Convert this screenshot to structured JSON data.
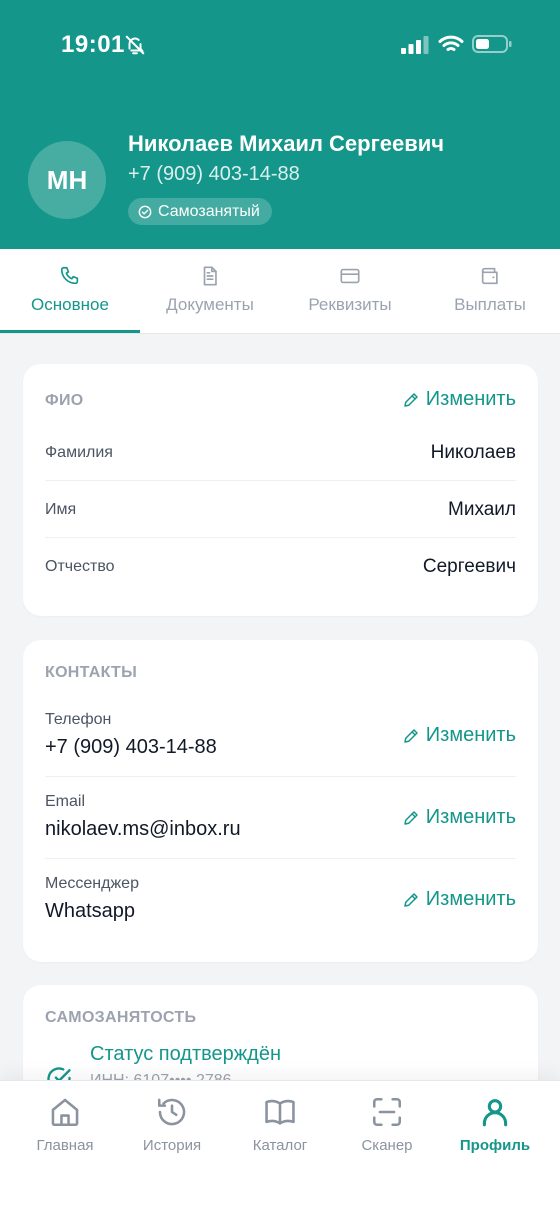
{
  "status_bar": {
    "time": "19:01"
  },
  "profile": {
    "initials": "МН",
    "name": "Николаев Михаил Сергеевич",
    "phone": "+7 (909) 403-14-88",
    "badge": "Самозанятый"
  },
  "tabs": [
    {
      "label": "Основное",
      "icon": "phone-icon",
      "active": true
    },
    {
      "label": "Документы",
      "icon": "document-icon"
    },
    {
      "label": "Реквизиты",
      "icon": "card-icon"
    },
    {
      "label": "Выплаты",
      "icon": "wallet-icon"
    }
  ],
  "fio": {
    "title": "ФИО",
    "edit": "Изменить",
    "rows": [
      {
        "label": "Фамилия",
        "value": "Николаев"
      },
      {
        "label": "Имя",
        "value": "Михаил"
      },
      {
        "label": "Отчество",
        "value": "Сергеевич"
      }
    ]
  },
  "contacts": {
    "title": "КОНТАКТЫ",
    "rows": [
      {
        "label": "Телефон",
        "value": "+7 (909) 403-14-88",
        "edit": "Изменить"
      },
      {
        "label": "Email",
        "value": "nikolaev.ms@inbox.ru",
        "edit": "Изменить"
      },
      {
        "label": "Мессенджер",
        "value": "Whatsapp",
        "edit": "Изменить"
      }
    ]
  },
  "selfemployed": {
    "title": "САМОЗАНЯТОСТЬ",
    "status": "Статус подтверждён",
    "inn": "ИНН: 6107•••• 2786"
  },
  "bottom_nav": [
    {
      "label": "Главная",
      "icon": "home-icon"
    },
    {
      "label": "История",
      "icon": "history-icon"
    },
    {
      "label": "Каталог",
      "icon": "book-icon"
    },
    {
      "label": "Сканер",
      "icon": "scanner-icon"
    },
    {
      "label": "Профиль",
      "icon": "user-icon",
      "active": true
    }
  ],
  "colors": {
    "accent": "#14968a",
    "background": "#f3f4f6"
  }
}
